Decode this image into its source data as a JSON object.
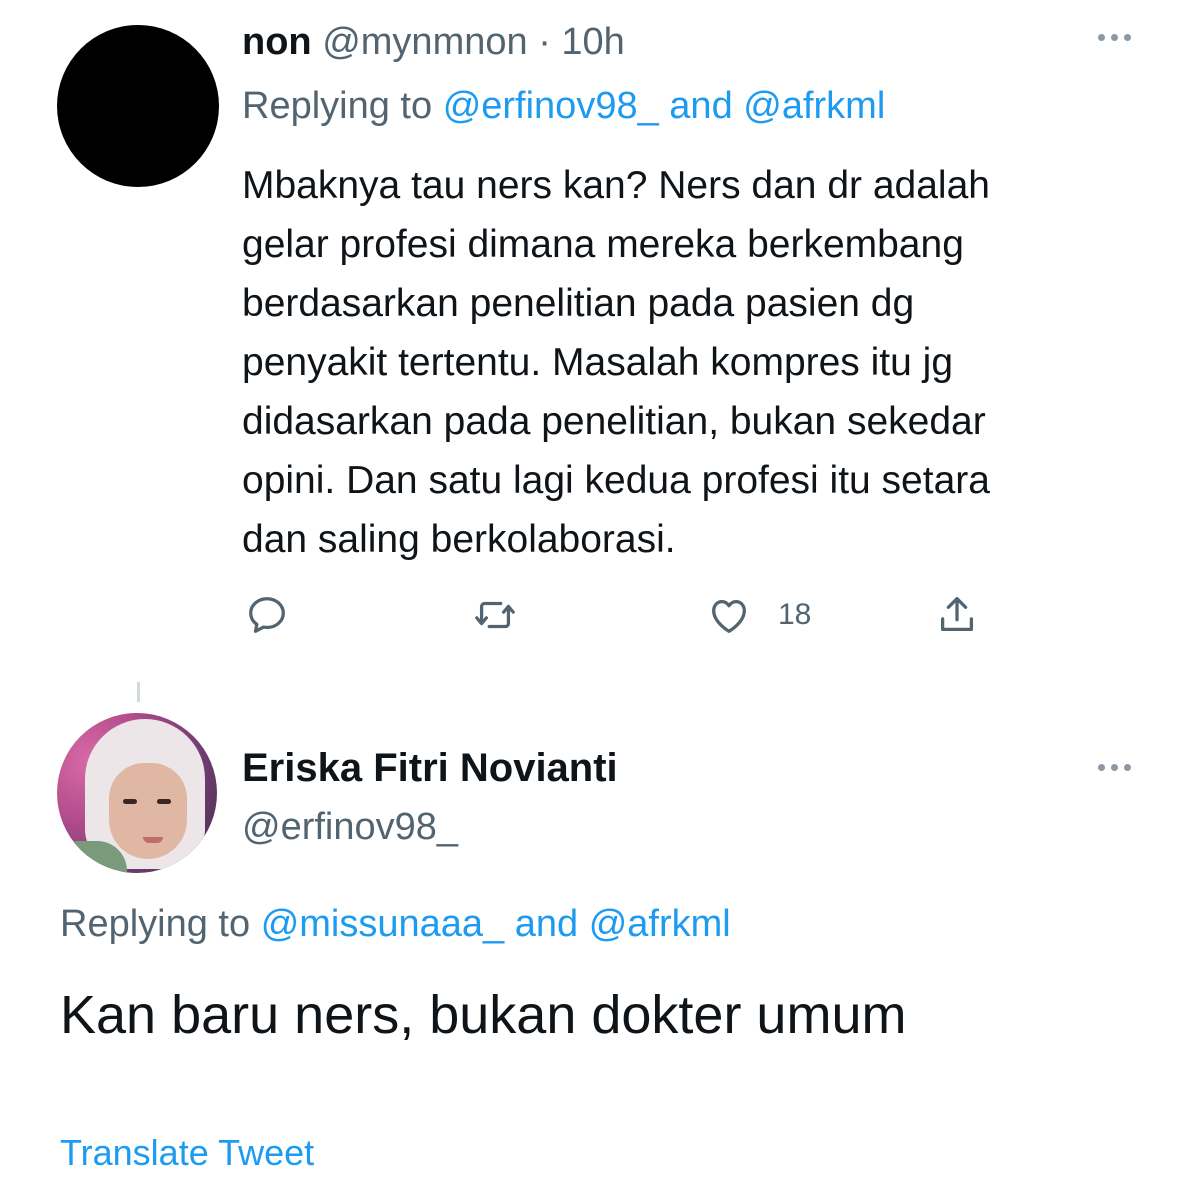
{
  "tweet1": {
    "name": "non",
    "handle": "@mynmnon",
    "separator": "·",
    "time": "10h",
    "replying_prefix": "Replying to",
    "reply_mention_1": "@erfinov98_",
    "reply_and": "and",
    "reply_mention_2": "@afrkml",
    "body_lines": [
      "Mbaknya tau ners kan? Ners dan dr adalah",
      "gelar profesi dimana mereka berkembang",
      "berdasarkan penelitian pada pasien dg",
      "penyakit tertentu. Masalah kompres itu jg",
      "didasarkan pada penelitian, bukan sekedar",
      "opini. Dan satu lagi kedua profesi itu setara",
      "dan saling berkolaborasi."
    ],
    "like_count": "18",
    "icons": [
      "reply-icon",
      "retweet-icon",
      "like-icon",
      "share-icon",
      "more-icon"
    ]
  },
  "tweet2": {
    "name": "Eriska Fitri Novianti",
    "handle": "@erfinov98_",
    "replying_prefix": "Replying to",
    "reply_mention_1": "@missunaaa_",
    "reply_and": "and",
    "reply_mention_2": "@afrkml",
    "body": "Kan baru ners, bukan dokter umum",
    "translate_label": "Translate Tweet"
  },
  "colors": {
    "text": "#0f1419",
    "secondary": "#536471",
    "link": "#1d9bf0",
    "divider": "#cfd9de"
  }
}
